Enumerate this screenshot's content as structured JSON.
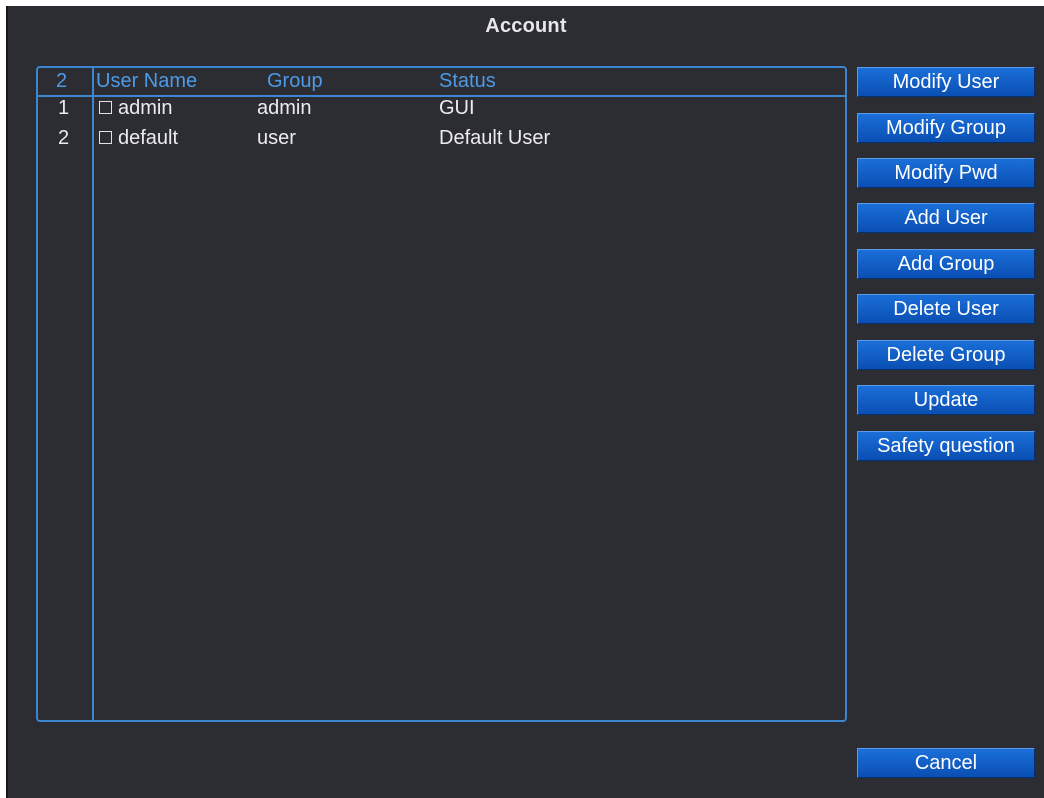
{
  "window": {
    "title": "Account"
  },
  "table": {
    "count": "2",
    "headers": {
      "user_name": "User Name",
      "group": "Group",
      "status": "Status"
    },
    "rows": [
      {
        "index": "1",
        "user_name": "admin",
        "group": "admin",
        "status": "GUI",
        "checked": false
      },
      {
        "index": "2",
        "user_name": "default",
        "group": "user",
        "status": "Default User",
        "checked": false
      }
    ]
  },
  "buttons": {
    "modify_user": "Modify User",
    "modify_group": "Modify Group",
    "modify_pwd": "Modify Pwd",
    "add_user": "Add User",
    "add_group": "Add Group",
    "delete_user": "Delete User",
    "delete_group": "Delete Group",
    "update": "Update",
    "safety_question": "Safety question",
    "cancel": "Cancel"
  },
  "colors": {
    "background": "#2c2d33",
    "accent_border": "#3b86cf",
    "header_text": "#4d9ae6",
    "button": "#0f5cc4"
  }
}
